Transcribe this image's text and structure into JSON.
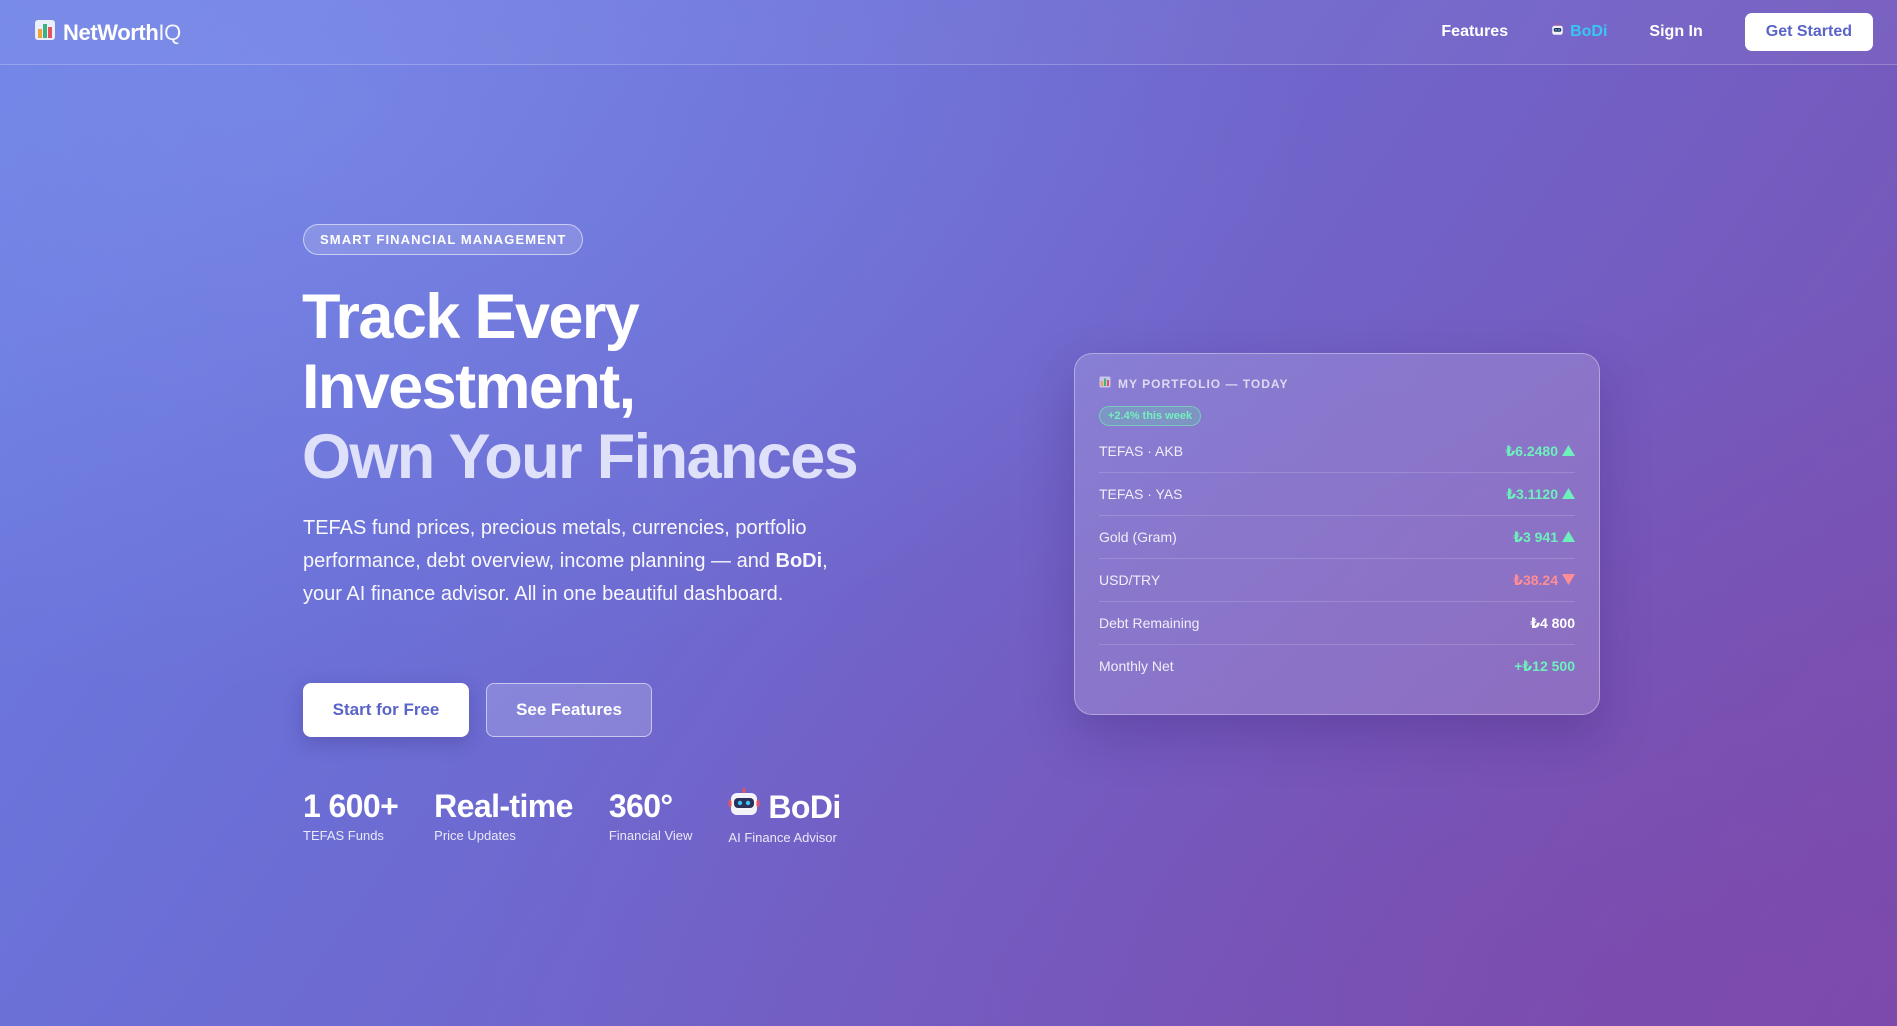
{
  "nav": {
    "brand_primary": "NetWorth",
    "brand_secondary": "IQ",
    "links": {
      "features": "Features",
      "bodi": "BoDi",
      "sign_in": "Sign In"
    },
    "cta": "Get Started"
  },
  "hero": {
    "pill": "SMART FINANCIAL MANAGEMENT",
    "headline": {
      "line1": "Track Every",
      "line2": "Investment,",
      "line3": "Own Your Finances"
    },
    "description": {
      "part1": "TEFAS fund prices, precious metals, currencies, portfolio performance, debt overview, income planning — and ",
      "bold": "BoDi",
      "part2": ", your AI finance advisor. All in one beautiful dashboard."
    },
    "buttons": {
      "primary": "Start for Free",
      "secondary": "See Features"
    },
    "stats": [
      {
        "value": "1 600+",
        "label": "TEFAS Funds"
      },
      {
        "value": "Real-time",
        "label": "Price Updates"
      },
      {
        "value": "360°",
        "label": "Financial View"
      },
      {
        "value": "BoDi",
        "label": "AI Finance Advisor"
      }
    ]
  },
  "portfolio": {
    "title": "MY PORTFOLIO — TODAY",
    "badge": "+2.4% this week",
    "rows": [
      {
        "label": "TEFAS · AKB",
        "value": "₺6.2480",
        "trend": "up"
      },
      {
        "label": "TEFAS · YAS",
        "value": "₺3.1120",
        "trend": "up"
      },
      {
        "label": "Gold (Gram)",
        "value": "₺3 941",
        "trend": "up"
      },
      {
        "label": "USD/TRY",
        "value": "₺38.24",
        "trend": "down"
      },
      {
        "label": "Debt Remaining",
        "value": "₺4 800",
        "trend": "none"
      },
      {
        "label": "Monthly Net",
        "value": "+₺12 500",
        "trend": "positive"
      }
    ]
  },
  "colors": {
    "accent": "#5a64c8",
    "link_bodi": "#38c6f4",
    "positive": "#6ef0bd",
    "negative": "#ff8d95"
  },
  "icons": {
    "brand": "bar-chart-icon",
    "bodi": "robot-icon",
    "card_title": "bar-chart-icon",
    "trend_up": "triangle-up-icon",
    "trend_down": "triangle-down-icon"
  }
}
